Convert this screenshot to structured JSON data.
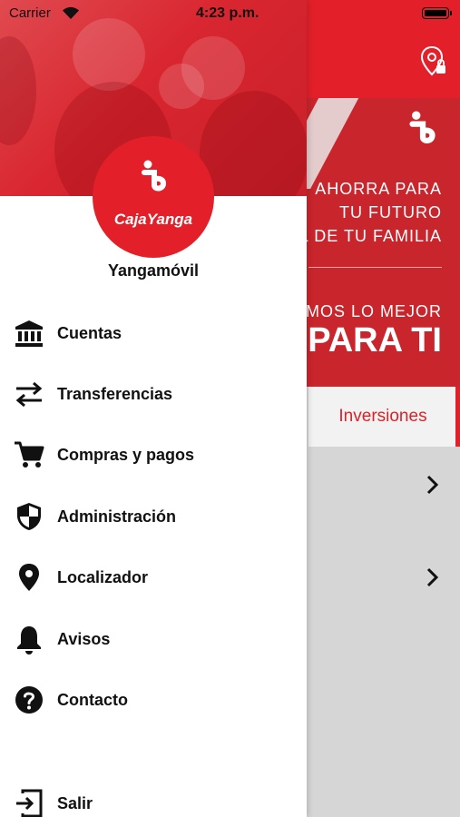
{
  "status_bar": {
    "carrier": "Carrier",
    "time": "4:23 p.m."
  },
  "drawer": {
    "logo_text": "CajaYanga",
    "app_name": "Yangamóvil",
    "menu": [
      {
        "label": "Cuentas",
        "icon": "bank-icon"
      },
      {
        "label": "Transferencias",
        "icon": "transfer-arrows-icon"
      },
      {
        "label": "Compras y pagos",
        "icon": "shopping-cart-icon"
      },
      {
        "label": "Administración",
        "icon": "shield-icon"
      },
      {
        "label": "Localizador",
        "icon": "location-pin-icon"
      },
      {
        "label": "Avisos",
        "icon": "bell-icon"
      },
      {
        "label": "Contacto",
        "icon": "help-circle-icon"
      },
      {
        "label": "Salir",
        "icon": "logout-icon"
      }
    ]
  },
  "background": {
    "banner": {
      "line1": "AHORRA PARA",
      "line2": "TU FUTURO",
      "line3": "L DE TU FAMILIA",
      "line4": "MOS LO MEJOR",
      "line5": "PARA TI"
    },
    "tab_label": "Inversiones"
  },
  "colors": {
    "brand_red": "#e3202a",
    "text_dark": "#111111",
    "background_gray": "#d6d6d6"
  }
}
